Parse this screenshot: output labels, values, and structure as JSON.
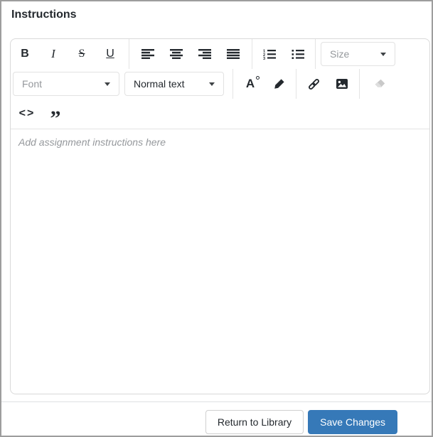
{
  "panel": {
    "title": "Instructions"
  },
  "toolbar": {
    "bold": "B",
    "italic": "I",
    "strikethrough": "S",
    "underline": "U",
    "size_dropdown": {
      "placeholder": "Size"
    },
    "font_dropdown": {
      "placeholder": "Font"
    },
    "paragraph_dropdown": {
      "value": "Normal text"
    },
    "color_button_letter": "A",
    "code_label": "<>",
    "quote_label": "”",
    "icons": {
      "align_left": "four-bars-left-aligned",
      "align_center": "four-bars-center-aligned",
      "align_right": "four-bars-right-aligned",
      "align_justify": "four-bars-justified",
      "ordered_list": "numbered-lines",
      "unordered_list": "bulleted-lines",
      "text_color": "A-with-circle",
      "highlighter": "marker-pen",
      "link": "chain",
      "image": "picture-with-mountain",
      "clear_format": "eraser",
      "dropdown_caret": "▾"
    }
  },
  "editor": {
    "placeholder": "Add assignment instructions here"
  },
  "footer": {
    "return_button_label": "Return to Library",
    "save_button_label": "Save Changes"
  },
  "colors": {
    "primary_button": "#3679b8",
    "primary_button_text": "#ffffff",
    "toolbar_icon": "#24292e",
    "disabled_icon": "#c9c9c9",
    "disabled_icon_light": "#dedede",
    "placeholder_text": "#95989c",
    "panel_border": "#9d9d9d",
    "container_border": "#d9d9d9",
    "divider": "#e4e4e4"
  }
}
